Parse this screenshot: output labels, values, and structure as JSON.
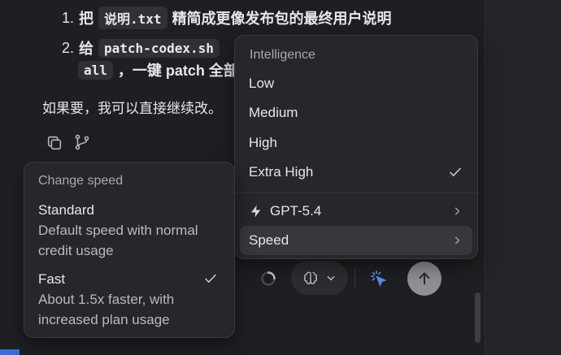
{
  "chat": {
    "item1": {
      "num": "1.",
      "prefix": "把",
      "code": "说明.txt",
      "text": "精简成更像发布包的最终用户说明"
    },
    "item2": {
      "num": "2.",
      "prefix": "给",
      "code": "patch-codex.sh",
      "code2": "all",
      "text2": "，一键 patch 全部"
    },
    "paragraph": "如果要，我可以直接继续改。"
  },
  "icons": {
    "copy": "copy-icon",
    "branch": "branch-icon",
    "bolt": "bolt-icon",
    "chevron": "chevron-right-icon",
    "check": "check-icon",
    "brain": "brain-icon",
    "cursor": "cursor-click-icon",
    "send": "arrow-up-icon"
  },
  "intelligence_menu": {
    "header": "Intelligence",
    "items": [
      {
        "label": "Low"
      },
      {
        "label": "Medium"
      },
      {
        "label": "High"
      },
      {
        "label": "Extra High",
        "checked": true
      }
    ],
    "model": {
      "label": "GPT-5.4"
    },
    "speed": {
      "label": "Speed"
    }
  },
  "speed_menu": {
    "header": "Change speed",
    "options": [
      {
        "title": "Standard",
        "desc1": "Default speed with normal",
        "desc2": "credit usage",
        "checked": false
      },
      {
        "title": "Fast",
        "desc1": "About 1.5x faster, with",
        "desc2": "increased plan usage",
        "checked": true
      }
    ]
  },
  "colors": {
    "background": "#1e1f22",
    "menu": "#26272b",
    "accent": "#5b8cf0",
    "send": "#8e9095"
  }
}
